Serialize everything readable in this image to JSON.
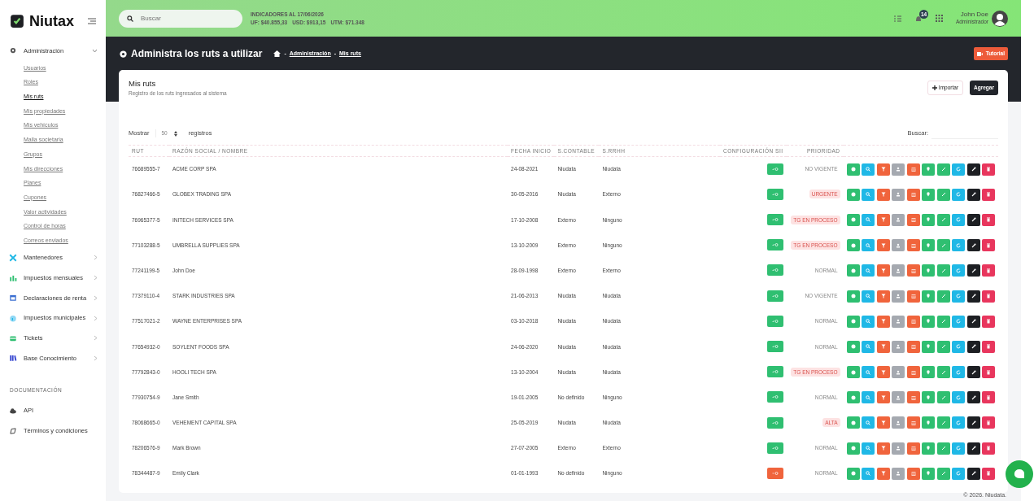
{
  "brand": "Niutax",
  "search": {
    "placeholder": "Buscar"
  },
  "indicators": {
    "title": "INDICADORES AL 17/06/2026",
    "values": [
      "UF: $40.855,33",
      "USD: $913,15",
      "UTM: $71.348"
    ]
  },
  "notifications": {
    "count": "14"
  },
  "user": {
    "name": "John Doe",
    "role": "Administrador"
  },
  "sidebar": {
    "items": [
      {
        "label": "Administración",
        "expanded": true,
        "children": [
          {
            "label": "Usuarios",
            "selected": false
          },
          {
            "label": "Roles",
            "selected": false
          },
          {
            "label": "Mis ruts",
            "selected": true
          },
          {
            "label": "Mis propiedades",
            "selected": false
          },
          {
            "label": "Mis vehículos",
            "selected": false
          },
          {
            "label": "Malla societaria",
            "selected": false
          },
          {
            "label": "Grupos",
            "selected": false
          },
          {
            "label": "Mis direcciones",
            "selected": false
          },
          {
            "label": "Planes",
            "selected": false
          },
          {
            "label": "Cupones",
            "selected": false
          },
          {
            "label": "Valor actividades",
            "selected": false
          },
          {
            "label": "Control de horas",
            "selected": false
          },
          {
            "label": "Correos enviados",
            "selected": false
          }
        ]
      },
      {
        "label": "Mantenedores",
        "expanded": false
      },
      {
        "label": "Impuestos mensuales",
        "expanded": false
      },
      {
        "label": "Declaraciones de renta",
        "expanded": false
      },
      {
        "label": "Impuestos municipales",
        "expanded": false
      },
      {
        "label": "Tickets",
        "expanded": false
      },
      {
        "label": "Base Conocimiento",
        "expanded": false
      }
    ],
    "section": "DOCUMENTACIÓN",
    "docs": [
      {
        "label": "API"
      },
      {
        "label": "Términos y condiciones"
      }
    ]
  },
  "page": {
    "title": "Administra los ruts a utilizar",
    "breadcrumb": [
      {
        "separator": "-",
        "label": "Administración"
      },
      {
        "separator": "-",
        "label": "Mis ruts"
      }
    ],
    "tutorial": "Tutorial"
  },
  "card": {
    "title": "Mis ruts",
    "subtitle": "Registro de los ruts ingresados al sistema",
    "buttons": [
      "Importar",
      "Agregar"
    ]
  },
  "length": {
    "before": "Mostrar",
    "value": "50",
    "after": "registros"
  },
  "filter": {
    "label": "Buscar:"
  },
  "table": {
    "columns": [
      "RUT",
      "RAZÓN SOCIAL / NOMBRE",
      "FECHA INICIO",
      "S.CONTABLE",
      "S.RRHH",
      "CONFIGURACIÓN SII",
      "PRIORIDAD"
    ],
    "rows": [
      {
        "rut": "76689555-7",
        "name": "ACME CORP SPA",
        "date": "24-08-2021",
        "contable": "Niudata",
        "rrhh": "Niudata",
        "sii_ok": true,
        "priority": "NO VIGENTE",
        "urgent": false
      },
      {
        "rut": "76827466-5",
        "name": "GLOBEX TRADING SPA",
        "date": "30-05-2016",
        "contable": "Niudata",
        "rrhh": "Externo",
        "sii_ok": true,
        "priority": "URGENTE",
        "urgent": true
      },
      {
        "rut": "76965377-5",
        "name": "INITECH SERVICES SPA",
        "date": "17-10-2008",
        "contable": "Externo",
        "rrhh": "Ninguno",
        "sii_ok": true,
        "priority": "TG EN PROCESO",
        "urgent": true
      },
      {
        "rut": "77103288-5",
        "name": "UMBRELLA SUPPLIES SPA",
        "date": "13-10-2009",
        "contable": "Externo",
        "rrhh": "Ninguno",
        "sii_ok": true,
        "priority": "TG EN PROCESO",
        "urgent": true
      },
      {
        "rut": "77241199-5",
        "name": "John Doe",
        "date": "28-09-1998",
        "contable": "Externo",
        "rrhh": "Externo",
        "sii_ok": true,
        "priority": "NORMAL",
        "urgent": false
      },
      {
        "rut": "77379110-4",
        "name": "STARK INDUSTRIES SPA",
        "date": "21-06-2013",
        "contable": "Niudata",
        "rrhh": "Niudata",
        "sii_ok": true,
        "priority": "NO VIGENTE",
        "urgent": false
      },
      {
        "rut": "77517021-2",
        "name": "WAYNE ENTERPRISES SPA",
        "date": "03-10-2018",
        "contable": "Niudata",
        "rrhh": "Niudata",
        "sii_ok": true,
        "priority": "NORMAL",
        "urgent": false
      },
      {
        "rut": "77654932-0",
        "name": "SOYLENT FOODS SPA",
        "date": "24-06-2020",
        "contable": "Niudata",
        "rrhh": "Niudata",
        "sii_ok": true,
        "priority": "NORMAL",
        "urgent": false
      },
      {
        "rut": "77792843-0",
        "name": "HOOLI TECH SPA",
        "date": "13-10-2004",
        "contable": "Niudata",
        "rrhh": "Niudata",
        "sii_ok": true,
        "priority": "TG EN PROCESO",
        "urgent": true
      },
      {
        "rut": "77930754-9",
        "name": "Jane Smith",
        "date": "19-01-2005",
        "contable": "No definido",
        "rrhh": "Ninguno",
        "sii_ok": true,
        "priority": "NORMAL",
        "urgent": false
      },
      {
        "rut": "78068665-0",
        "name": "VEHEMENT CAPITAL SPA",
        "date": "25-05-2019",
        "contable": "Niudata",
        "rrhh": "Niudata",
        "sii_ok": true,
        "priority": "ALTA",
        "urgent": true
      },
      {
        "rut": "78206576-9",
        "name": "Mark Brown",
        "date": "27-07-2005",
        "contable": "Externo",
        "rrhh": "Externo",
        "sii_ok": true,
        "priority": "NORMAL",
        "urgent": false
      },
      {
        "rut": "78344487-9",
        "name": "Emily Clark",
        "date": "01-01-1993",
        "contable": "No definido",
        "rrhh": "Ninguno",
        "sii_ok": false,
        "priority": "NORMAL",
        "urgent": false
      }
    ]
  },
  "footer": "© 2026. Niudata."
}
